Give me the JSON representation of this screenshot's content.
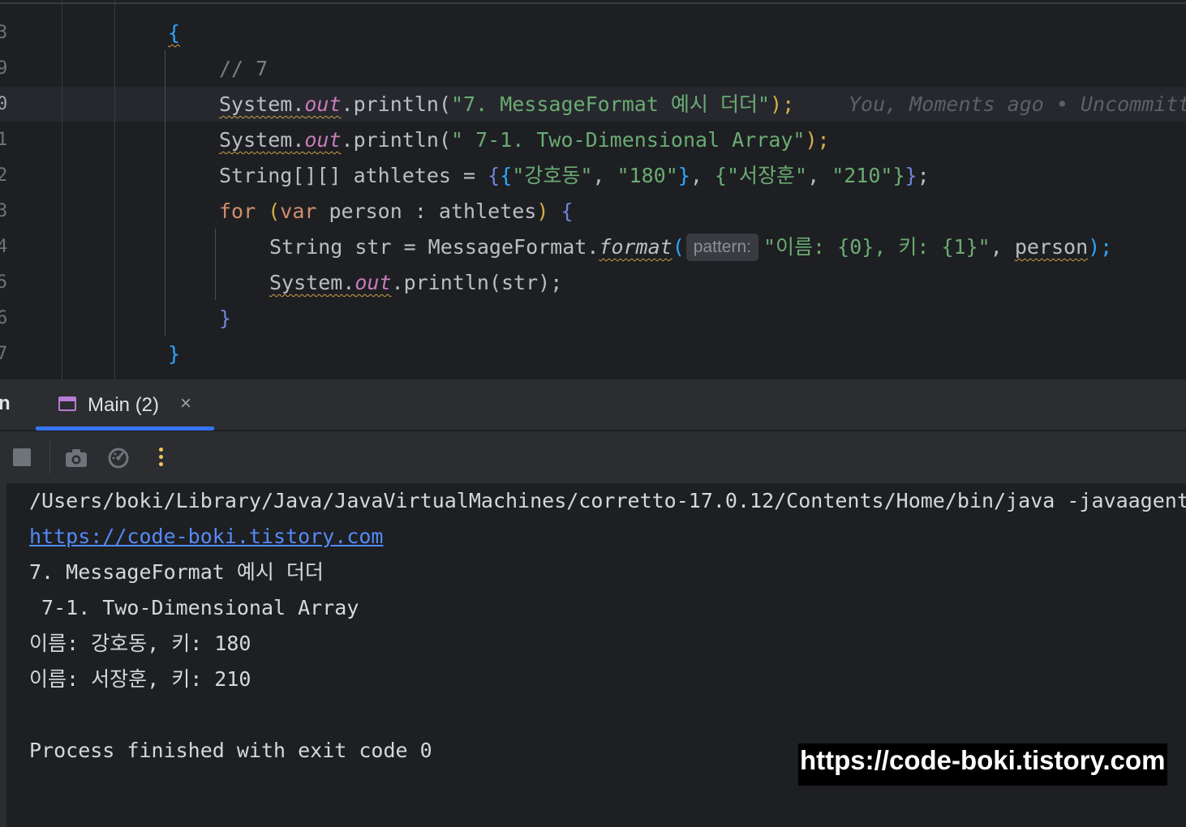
{
  "editor": {
    "line_numbers": [
      "3",
      "9",
      "0",
      "1",
      "2",
      "3",
      "4",
      "5",
      "6",
      "7"
    ],
    "lines": {
      "l1_open": "{",
      "l2_comment": "// 7",
      "l3_sys": "System",
      "l3_dot1": ".",
      "l3_out": "out",
      "l3_println": ".println(",
      "l3_str": "\"7. MessageFormat 예시 더더\"",
      "l3_close": ");",
      "l3_blame": "You, Moments ago • Uncommitted changes",
      "l4_sys": "System",
      "l4_dot1": ".",
      "l4_out": "out",
      "l4_println": ".println(",
      "l4_str": "\" 7-1. Two-Dimensional Array\"",
      "l4_close": ");",
      "l5_type": "String[][] athletes = ",
      "l5_ob1": "{",
      "l5_ob2": "{",
      "l5_s1": "\"강호동\"",
      "l5_comma1": ", ",
      "l5_s2": "\"180\"",
      "l5_cb2": "}",
      "l5_comma2": ", ",
      "l5_ob3": "{",
      "l5_s3": "\"서장훈\"",
      "l5_comma3": ", ",
      "l5_s4": "\"210\"",
      "l5_cb3": "}",
      "l5_cb1": "}",
      "l5_semi": ";",
      "l6_for": "for",
      "l6_paren_open": " (",
      "l6_var": "var",
      "l6_rest": " person : athletes",
      "l6_paren_close": ") ",
      "l6_brace": "{",
      "l7_decl": "String str = MessageFormat.",
      "l7_format": "format",
      "l7_paren": "(",
      "l7_hint": "pattern:",
      "l7_str": "\"이름: {0}, 키: {1}\"",
      "l7_comma": ", ",
      "l7_person": "person",
      "l7_close": ");",
      "l8_sys": "System",
      "l8_dot1": ".",
      "l8_out": "out",
      "l8_println": ".println(str);",
      "l9_close": "}",
      "l10_close": "}"
    }
  },
  "run_panel": {
    "cut_label": "n",
    "tab_label": "Main (2)",
    "tab_close": "×"
  },
  "console": {
    "cmd": "/Users/boki/Library/Java/JavaVirtualMachines/corretto-17.0.12/Contents/Home/bin/java -javaagent",
    "link": "https://code-boki.tistory.com",
    "out1": "7. MessageFormat 예시 더더",
    "out2": " 7-1. Two-Dimensional Array",
    "out3": "이름: 강호동, 키: 180",
    "out4": "이름: 서장훈, 키: 210",
    "exit": "Process finished with exit code 0"
  },
  "watermark": "https://code-boki.tistory.com",
  "colors": {
    "keyword": "#cf8e6d",
    "string": "#6aab73",
    "static_field": "#c77dbb",
    "link": "#548af7",
    "tab_accent": "#3574f0"
  },
  "icons": [
    "stop-icon",
    "camera-icon",
    "profiler-icon",
    "more-icon",
    "console-tab-icon",
    "close-icon"
  ]
}
